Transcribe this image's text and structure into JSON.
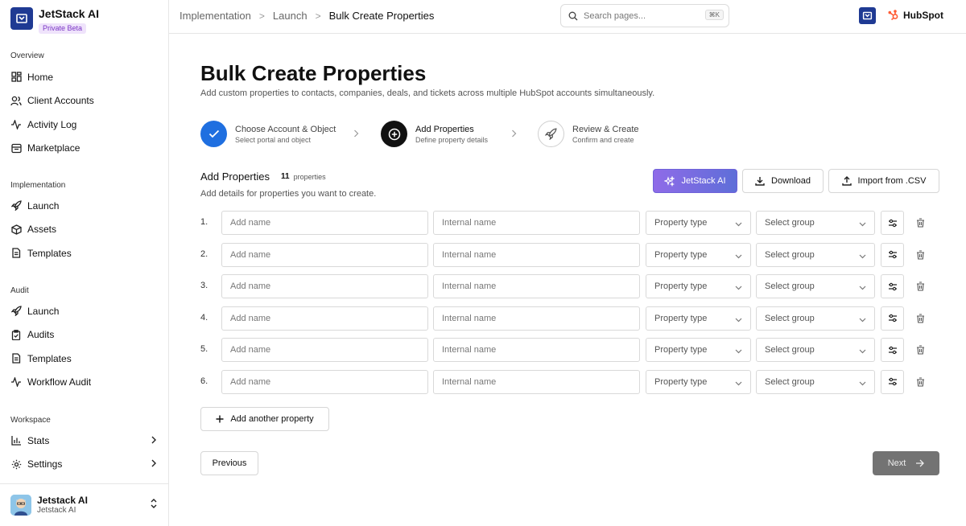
{
  "brand": {
    "name": "JetStack AI",
    "badge": "Private Beta"
  },
  "sidebar": {
    "groups": [
      {
        "title": "Overview",
        "items": [
          {
            "label": "Home",
            "icon": "grid-icon"
          },
          {
            "label": "Client Accounts",
            "icon": "users-icon"
          },
          {
            "label": "Activity Log",
            "icon": "activity-icon"
          },
          {
            "label": "Marketplace",
            "icon": "store-icon"
          }
        ]
      },
      {
        "title": "Implementation",
        "items": [
          {
            "label": "Launch",
            "icon": "rocket-icon"
          },
          {
            "label": "Assets",
            "icon": "box-icon"
          },
          {
            "label": "Templates",
            "icon": "document-icon"
          }
        ]
      },
      {
        "title": "Audit",
        "items": [
          {
            "label": "Launch",
            "icon": "rocket-icon"
          },
          {
            "label": "Audits",
            "icon": "clipboard-check-icon"
          },
          {
            "label": "Templates",
            "icon": "document-icon"
          },
          {
            "label": "Workflow Audit",
            "icon": "activity-icon"
          }
        ]
      },
      {
        "title": "Workspace",
        "items": [
          {
            "label": "Stats",
            "icon": "bar-chart-icon"
          },
          {
            "label": "Settings",
            "icon": "gear-icon"
          }
        ]
      }
    ],
    "user": {
      "name": "Jetstack AI",
      "sub": "Jetstack AI"
    }
  },
  "topbar": {
    "breadcrumbs": [
      "Implementation",
      "Launch",
      "Bulk Create Properties"
    ],
    "search_placeholder": "Search pages...",
    "search_shortcut": "⌘K",
    "hubspot_label": "HubSpot"
  },
  "page": {
    "title": "Bulk Create Properties",
    "subtitle": "Add custom properties to contacts, companies, deals, and tickets across multiple HubSpot accounts simultaneously."
  },
  "steps": [
    {
      "title": "Choose Account & Object",
      "sub": "Select portal and object",
      "state": "done"
    },
    {
      "title": "Add Properties",
      "sub": "Define property details",
      "state": "current"
    },
    {
      "title": "Review & Create",
      "sub": "Confirm and create",
      "state": "upcoming"
    }
  ],
  "section": {
    "title": "Add Properties",
    "count": "11",
    "count_label": "properties",
    "subtitle": "Add details for properties you want to create."
  },
  "toolbar": {
    "ai_label": "JetStack AI",
    "download_label": "Download",
    "import_label": "Import from .CSV"
  },
  "rows": [
    {
      "num": "1.",
      "name_placeholder": "Add name",
      "internal_placeholder": "Internal name",
      "type_placeholder": "Property type",
      "group_placeholder": "Select group"
    },
    {
      "num": "2.",
      "name_placeholder": "Add name",
      "internal_placeholder": "Internal name",
      "type_placeholder": "Property type",
      "group_placeholder": "Select group"
    },
    {
      "num": "3.",
      "name_placeholder": "Add name",
      "internal_placeholder": "Internal name",
      "type_placeholder": "Property type",
      "group_placeholder": "Select group"
    },
    {
      "num": "4.",
      "name_placeholder": "Add name",
      "internal_placeholder": "Internal name",
      "type_placeholder": "Property type",
      "group_placeholder": "Select group"
    },
    {
      "num": "5.",
      "name_placeholder": "Add name",
      "internal_placeholder": "Internal name",
      "type_placeholder": "Property type",
      "group_placeholder": "Select group"
    },
    {
      "num": "6.",
      "name_placeholder": "Add name",
      "internal_placeholder": "Internal name",
      "type_placeholder": "Property type",
      "group_placeholder": "Select group"
    }
  ],
  "actions": {
    "add_label": "Add another property",
    "prev_label": "Previous",
    "next_label": "Next"
  },
  "colors": {
    "brand": "#1f3a93",
    "step_done": "#1f6fe0",
    "step_current": "#111111",
    "ai_gradient_start": "#8f6be8",
    "ai_gradient_end": "#5e6ed8",
    "next_disabled": "#737373",
    "hubspot": "#ff5c35"
  }
}
